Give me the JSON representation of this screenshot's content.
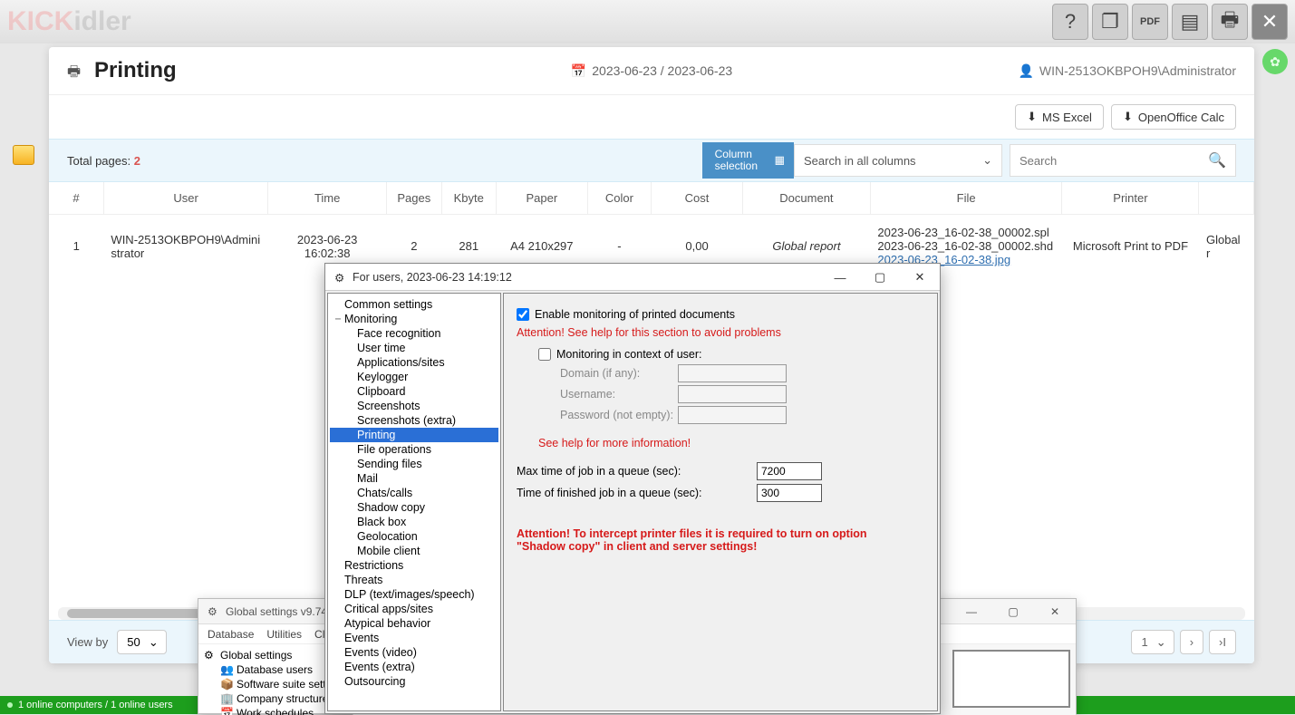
{
  "bgLogo": {
    "part1": "KICK",
    "part2": "idler"
  },
  "bgToolbarIcons": [
    "help-icon",
    "copy-icon",
    "pdf-icon",
    "archive-icon",
    "print-icon",
    "close-icon"
  ],
  "status": "1 online computers / 1 online users",
  "printing": {
    "title": "Printing",
    "dateRange": "2023-06-23 / 2023-06-23",
    "user": "WIN-2513OKBPOH9\\Administrator",
    "btnExcel": "MS Excel",
    "btnCalc": "OpenOffice Calc",
    "totalPagesLabel": "Total pages: ",
    "totalPagesValue": "2",
    "columnSelection": "Column selection",
    "searchCols": "Search in all columns",
    "searchPlaceholder": "Search",
    "columns": [
      "#",
      "User",
      "Time",
      "Pages",
      "Kbyte",
      "Paper",
      "Color",
      "Cost",
      "Document",
      "File",
      "Printer",
      ""
    ],
    "row": {
      "num": "1",
      "user": "WIN-2513OKBPOH9\\Administrator",
      "time": "2023-06-23 16:02:38",
      "pages": "2",
      "kbyte": "281",
      "paper": "A4 210x297",
      "color": "-",
      "cost": "0,00",
      "document": "Global report",
      "fileA": "2023-06-23_16-02-38_00002.spl",
      "fileB": "2023-06-23_16-02-38_00002.shd",
      "fileC": "2023-06-23_16-02-38.jpg",
      "printer": "Microsoft Print to PDF",
      "extra": "Global r"
    },
    "viewBy": "View by",
    "perPage": "50",
    "pageSel": "1",
    "next": "›",
    "last": "›I"
  },
  "gs": {
    "title": "Global settings v9.74",
    "menu": [
      "Database",
      "Utilities",
      "Cl"
    ],
    "tree": [
      "Global settings",
      "Database users",
      "Software suite sett…",
      "Company structure",
      "Work schedules"
    ]
  },
  "fu": {
    "title": "For users, 2023-06-23 14:19:12",
    "tree": [
      {
        "t": "Common settings",
        "lvl": 0,
        "exp": ""
      },
      {
        "t": "Monitoring",
        "lvl": 0,
        "exp": "−"
      },
      {
        "t": "Face recognition",
        "lvl": 2
      },
      {
        "t": "User time",
        "lvl": 2
      },
      {
        "t": "Applications/sites",
        "lvl": 2
      },
      {
        "t": "Keylogger",
        "lvl": 2
      },
      {
        "t": "Clipboard",
        "lvl": 2
      },
      {
        "t": "Screenshots",
        "lvl": 2
      },
      {
        "t": "Screenshots (extra)",
        "lvl": 2
      },
      {
        "t": "Printing",
        "lvl": 2,
        "sel": true
      },
      {
        "t": "File operations",
        "lvl": 2
      },
      {
        "t": "Sending files",
        "lvl": 2
      },
      {
        "t": "Mail",
        "lvl": 2
      },
      {
        "t": "Chats/calls",
        "lvl": 2
      },
      {
        "t": "Shadow copy",
        "lvl": 2
      },
      {
        "t": "Black box",
        "lvl": 2
      },
      {
        "t": "Geolocation",
        "lvl": 2
      },
      {
        "t": "Mobile client",
        "lvl": 2
      },
      {
        "t": "Restrictions",
        "lvl": 0
      },
      {
        "t": "Threats",
        "lvl": 0
      },
      {
        "t": "DLP (text/images/speech)",
        "lvl": 0
      },
      {
        "t": "Critical apps/sites",
        "lvl": 0
      },
      {
        "t": "Atypical behavior",
        "lvl": 0
      },
      {
        "t": "Events",
        "lvl": 0
      },
      {
        "t": "Events (video)",
        "lvl": 0
      },
      {
        "t": "Events (extra)",
        "lvl": 0
      },
      {
        "t": "Outsourcing",
        "lvl": 0
      }
    ],
    "chkEnable": "Enable monitoring of printed documents",
    "warn1": "Attention! See help for this section to avoid problems",
    "chkUserCtx": "Monitoring in context of user:",
    "fDomain": "Domain (if any):",
    "fUser": "Username:",
    "fPass": "Password (not empty):",
    "warn2": "See help for more information!",
    "maxQ": "Max time of job in a queue (sec):",
    "maxQval": "7200",
    "finQ": "Time of finished job in a queue (sec):",
    "finQval": "300",
    "warn3": "Attention! To intercept printer files it is required to turn on option \"Shadow copy\" in client and server settings!"
  }
}
